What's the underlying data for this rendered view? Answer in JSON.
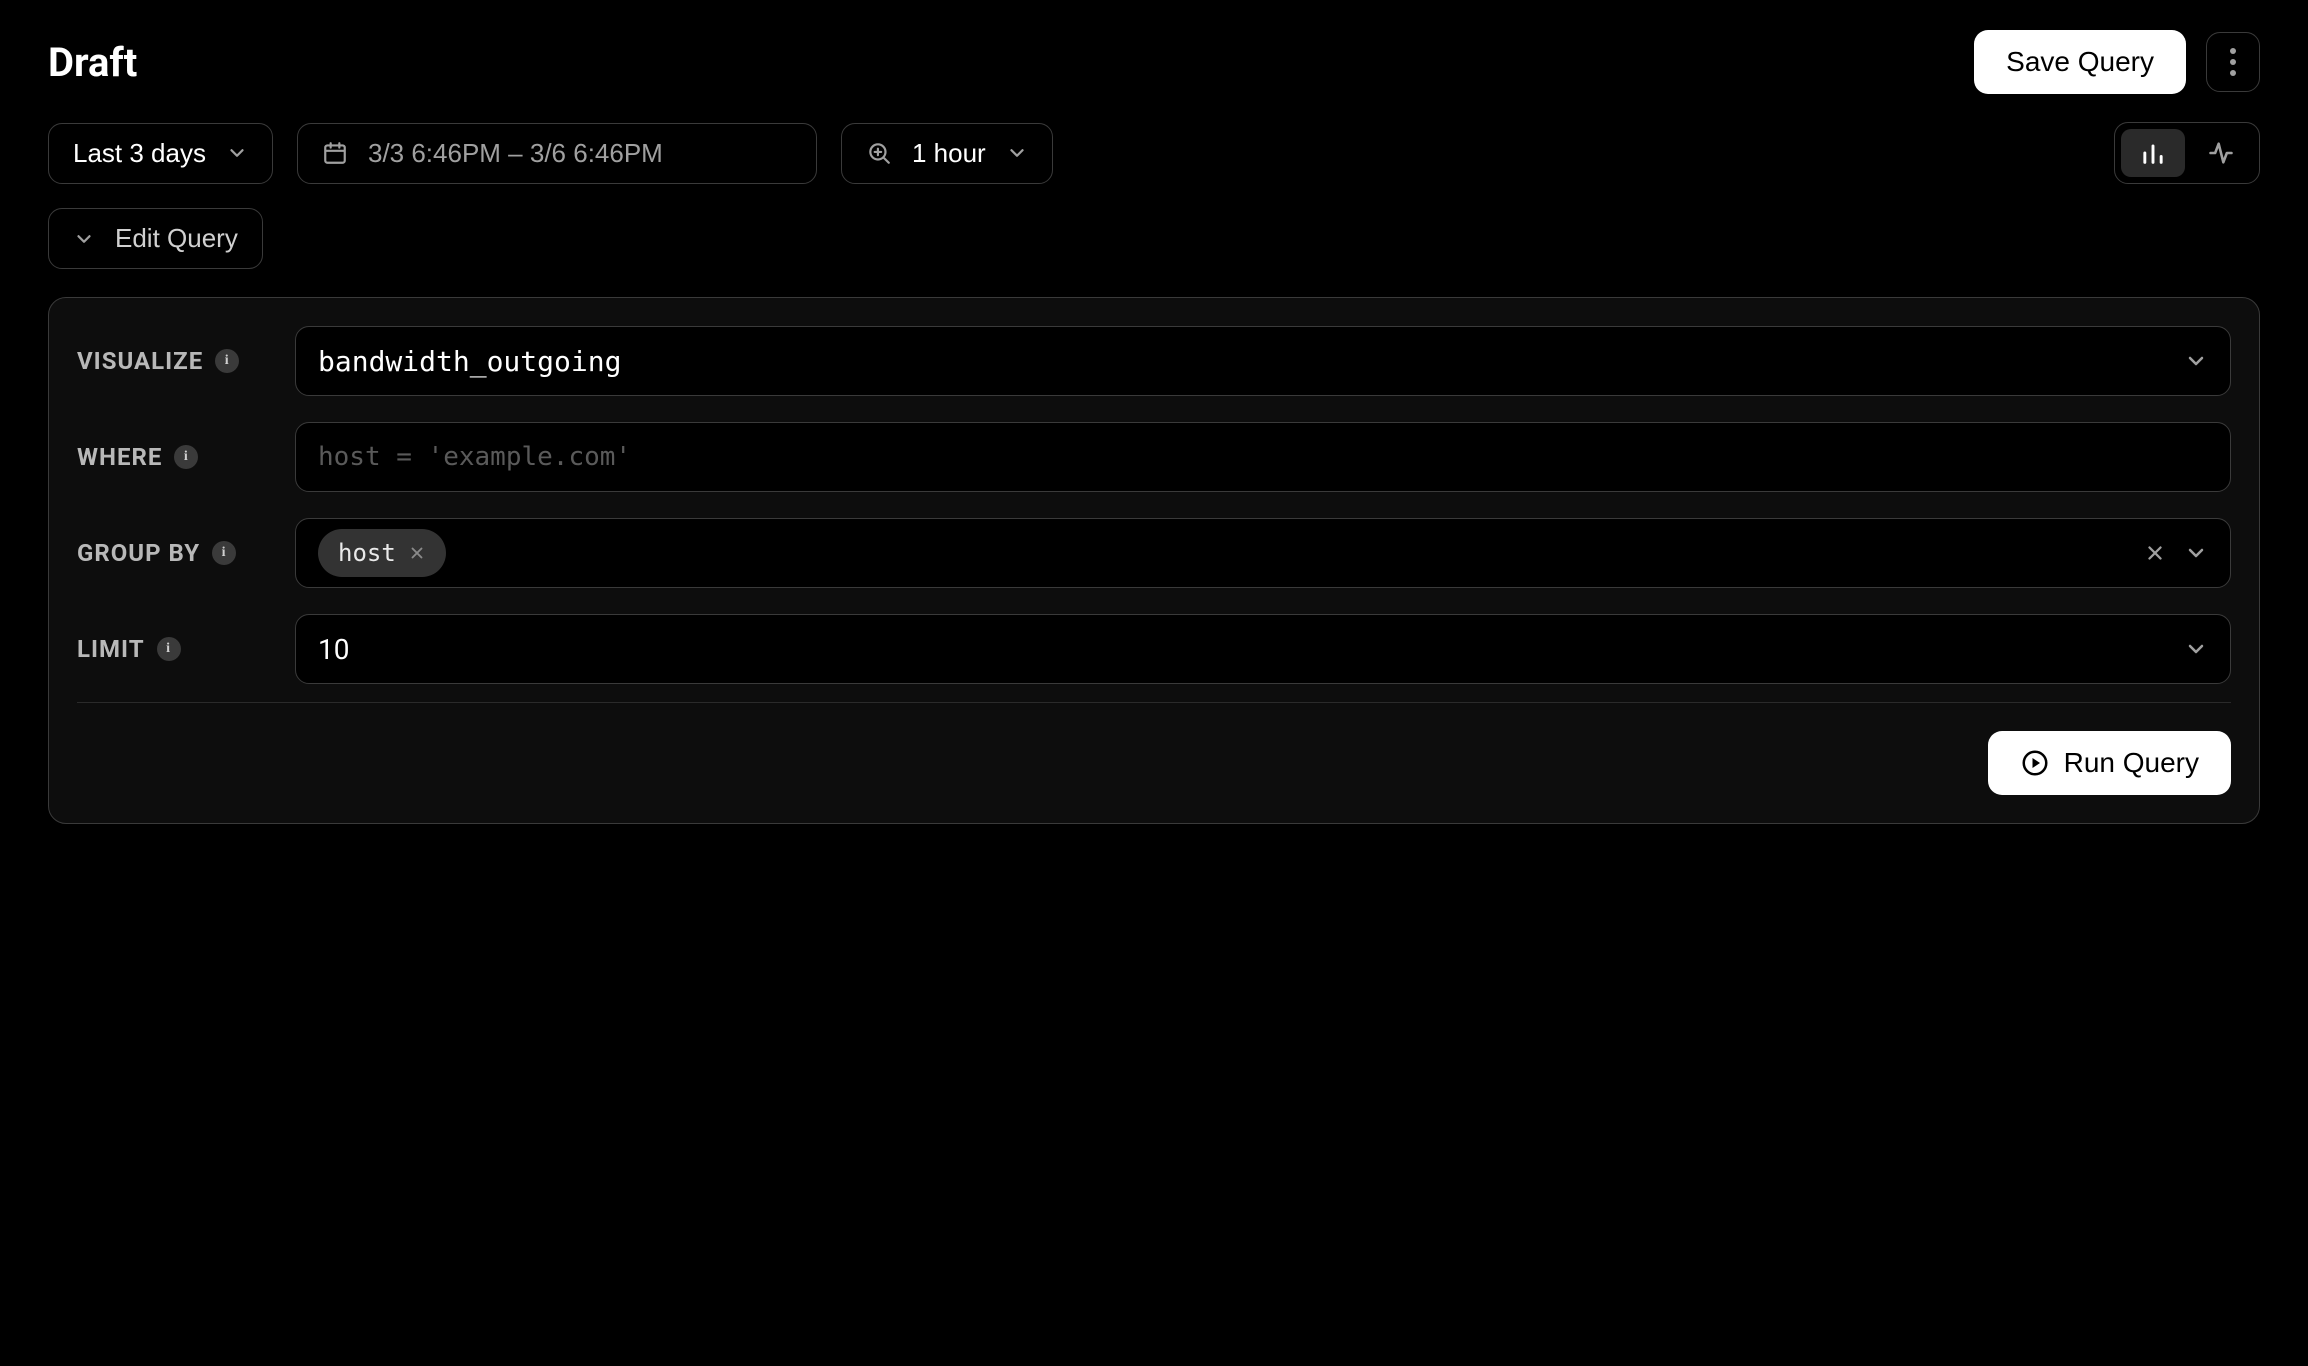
{
  "header": {
    "title": "Draft",
    "save_label": "Save Query"
  },
  "controls": {
    "time_preset": "Last 3 days",
    "date_range": "3/3 6:46PM – 3/6 6:46PM",
    "interval": "1 hour",
    "edit_query_label": "Edit Query",
    "view_mode": "chart"
  },
  "query": {
    "visualize": {
      "label": "VISUALIZE",
      "value": "bandwidth_outgoing"
    },
    "where": {
      "label": "WHERE",
      "value": "",
      "placeholder": "host = 'example.com'"
    },
    "group_by": {
      "label": "GROUP BY",
      "tags": [
        "host"
      ]
    },
    "limit": {
      "label": "LIMIT",
      "value": "10"
    },
    "run_label": "Run Query"
  },
  "icons": {
    "info_glyph": "i"
  }
}
